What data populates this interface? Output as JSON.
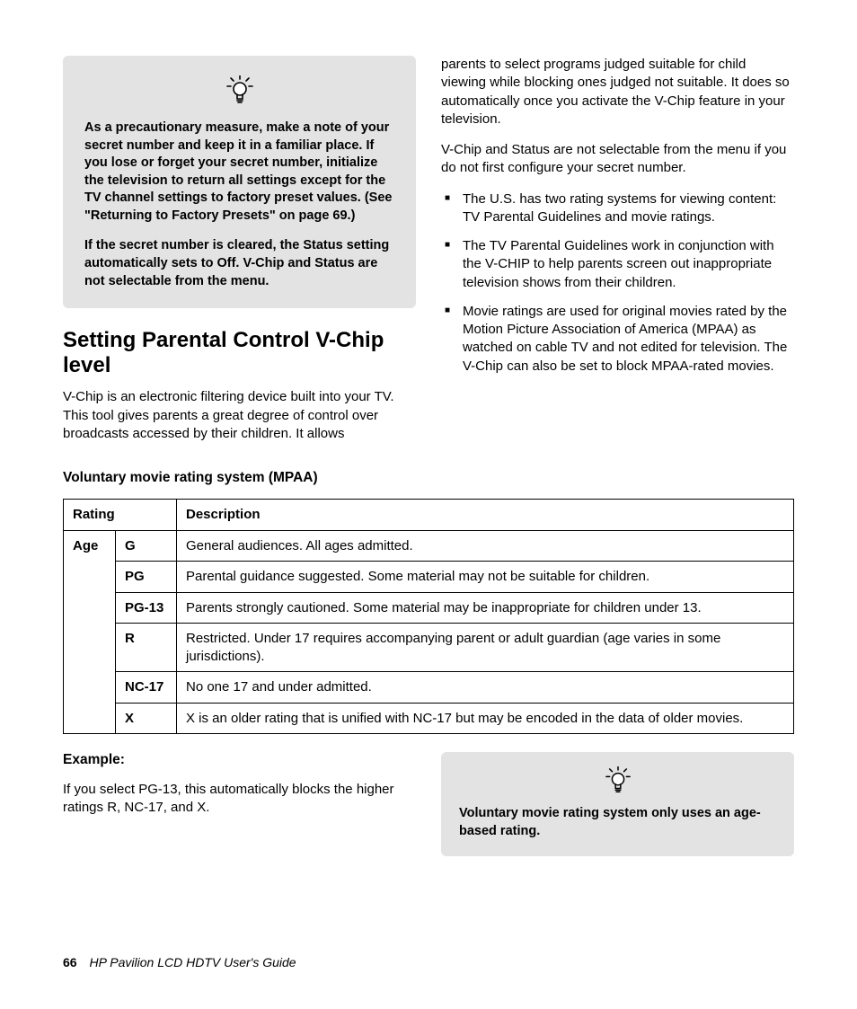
{
  "callout1": {
    "p1": "As a precautionary measure, make a note of your secret number and keep it in a familiar place. If you lose or forget your secret number, initialize the television to return all settings except for the TV channel settings to factory preset values. (See \"Returning to Factory Presets\" on page 69.)",
    "p2": "If the secret number is cleared, the Status setting automatically sets to Off. V-Chip and Status are not selectable from the menu."
  },
  "heading": "Setting Parental Control V-Chip level",
  "intro": "V-Chip is an electronic filtering device built into your TV. This tool gives parents a great degree of control over broadcasts accessed by their children. It allows",
  "right_p1": "parents to select programs judged suitable for child viewing while blocking ones judged not suitable. It does so automatically once you activate the V-Chip feature in your television.",
  "right_p2": "V-Chip and Status are not selectable from the menu if you do not first configure your secret number.",
  "bullets": [
    "The U.S. has two rating systems for viewing content: TV Parental Guidelines and movie ratings.",
    "The TV Parental Guidelines work in conjunction with the V-CHIP to help parents screen out inappropriate television shows from their children.",
    "Movie ratings are used for original movies rated by the Motion Picture Association of America (MPAA) as watched on cable TV and not edited for television. The V-Chip can also be set to block MPAA-rated movies."
  ],
  "table_title": "Voluntary movie rating system (MPAA)",
  "table": {
    "h_rating": "Rating",
    "h_desc": "Description",
    "age_label": "Age",
    "rows": [
      {
        "code": "G",
        "desc": "General audiences. All ages admitted."
      },
      {
        "code": "PG",
        "desc": "Parental guidance suggested. Some material may not be suitable for children."
      },
      {
        "code": "PG-13",
        "desc": "Parents strongly cautioned. Some material may be inappropriate for children under 13."
      },
      {
        "code": "R",
        "desc": "Restricted. Under 17 requires accompanying parent or adult guardian (age varies in some jurisdictions)."
      },
      {
        "code": "NC-17",
        "desc": "No one 17 and under admitted."
      },
      {
        "code": "X",
        "desc": "X is an older rating that is unified with NC-17 but may be encoded in the data of older movies."
      }
    ]
  },
  "example_heading": "Example:",
  "example_text": "If you select PG-13, this automatically blocks the higher ratings R, NC-17, and X.",
  "callout2": "Voluntary movie rating system only uses an age-based rating.",
  "footer": {
    "page": "66",
    "title": "HP Pavilion LCD HDTV User's Guide"
  }
}
